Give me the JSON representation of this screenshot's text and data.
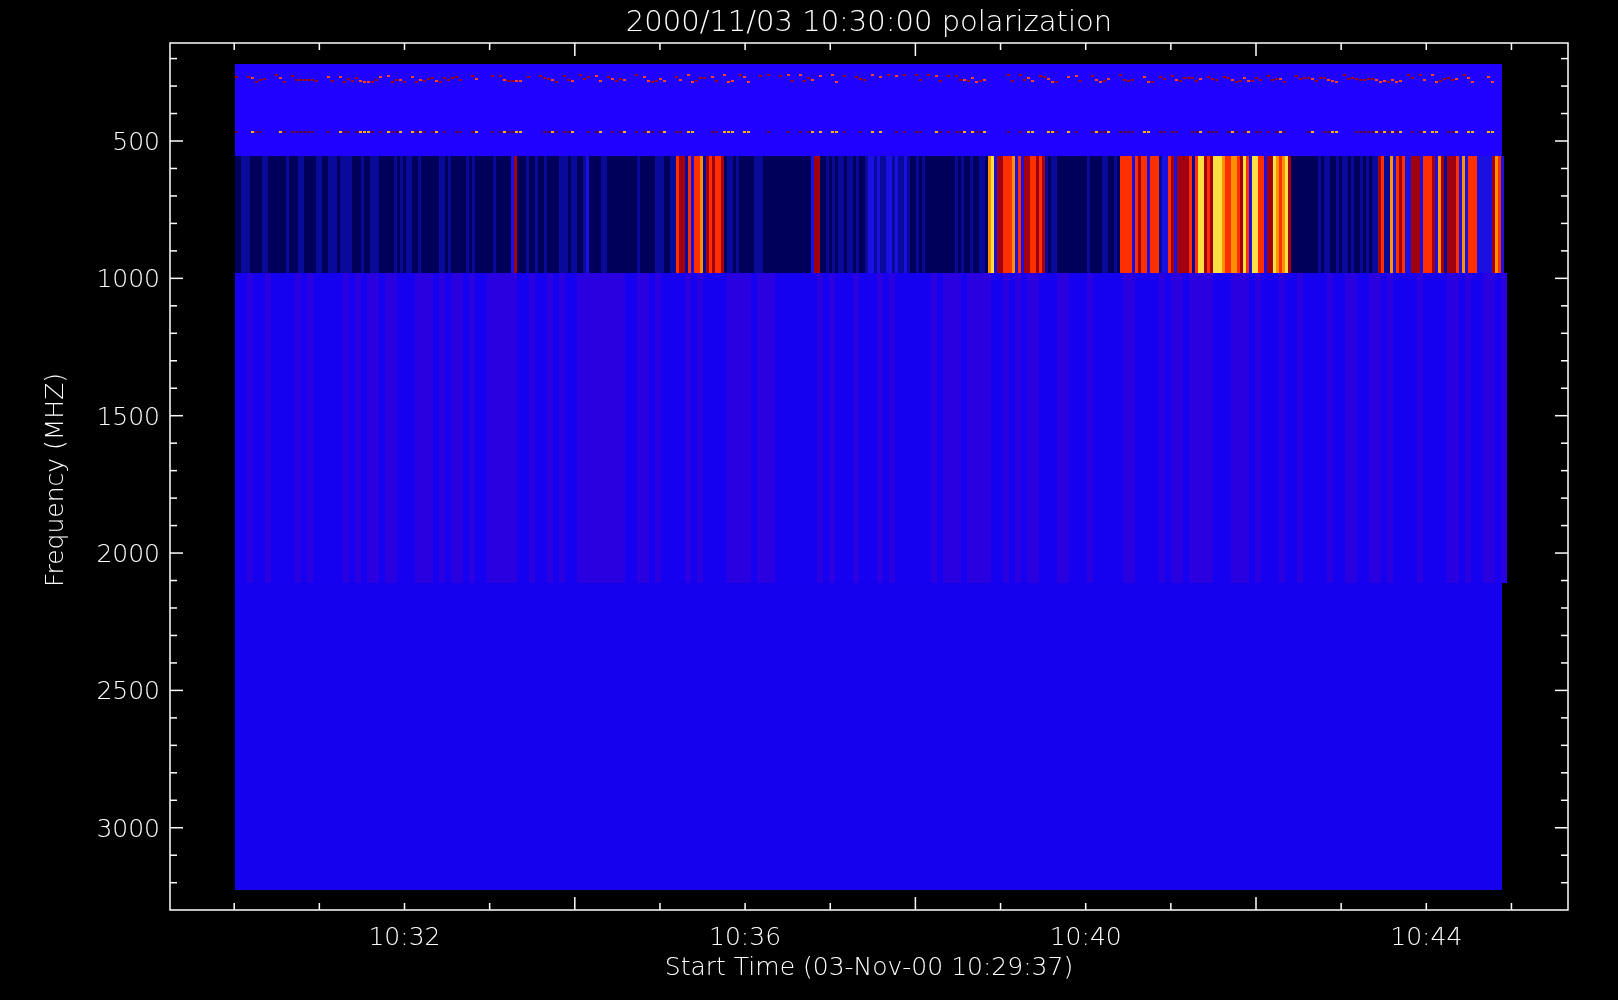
{
  "title": "2000/11/03 10:30:00 polarization",
  "y_axis": {
    "label": "Frequency (MHZ)",
    "ticks": [
      "500",
      "1000",
      "1500",
      "2000",
      "2500",
      "3000"
    ]
  },
  "x_axis": {
    "label": "Start Time (03-Nov-00 10:29:37)",
    "ticks": [
      "10:32",
      "10:36",
      "10:40",
      "10:44"
    ]
  }
}
